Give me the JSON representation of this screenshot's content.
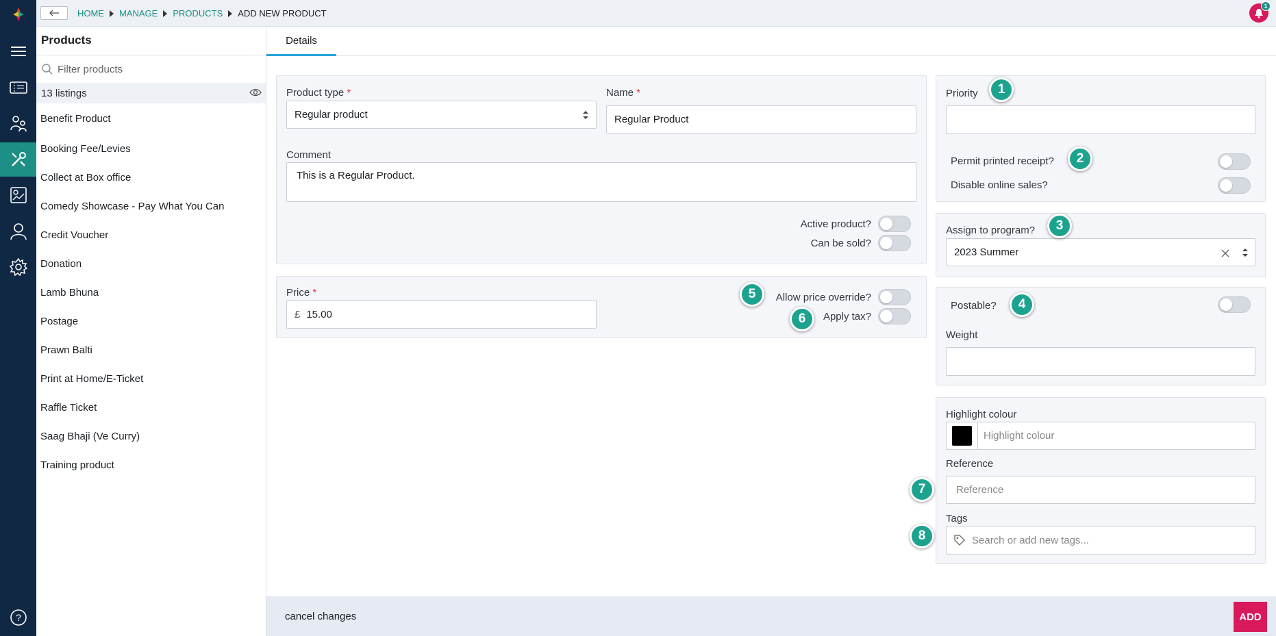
{
  "app": {
    "logo_icon": "brand-logo-icon",
    "accent": "#1d8f85",
    "brand": "#d8195c"
  },
  "rail": {
    "items": [
      "menu-icon",
      "ticket-icon",
      "people-icon",
      "tools-icon",
      "report-icon",
      "user-icon",
      "gear-icon",
      "help-icon"
    ]
  },
  "breadcrumb": {
    "home": "HOME",
    "manage": "MANAGE",
    "products": "PRODUCTS",
    "current": "ADD NEW PRODUCT"
  },
  "notifications": {
    "count": "1"
  },
  "sidebar": {
    "title": "Products",
    "filter_placeholder": "Filter products",
    "listing_count": "13",
    "listing_word": "listings",
    "items": [
      "Benefit Product",
      "Booking Fee/Levies",
      "Collect at Box office",
      "Comedy Showcase - Pay What You Can",
      "Credit Voucher",
      "Donation",
      "Lamb Bhuna",
      "Postage",
      "Prawn Balti",
      "Print at Home/E-Ticket",
      "Raffle Ticket",
      "Saag Bhaji (Ve Curry)",
      "Training product"
    ]
  },
  "tabs": {
    "details": "Details"
  },
  "form": {
    "product_type_label": "Product type",
    "product_type_value": "Regular product",
    "name_label": "Name",
    "name_value": "Regular Product",
    "comment_label": "Comment",
    "comment_value": "This is a Regular Product.",
    "active_label": "Active product?",
    "sold_label": "Can be sold?",
    "price_label": "Price",
    "currency": "£",
    "price_value": "15.00",
    "override_label": "Allow price override?",
    "tax_label": "Apply tax?",
    "priority_label": "Priority",
    "receipt_label": "Permit printed receipt?",
    "disable_online_label": "Disable online sales?",
    "program_label": "Assign to program?",
    "program_value": "2023 Summer",
    "postable_label": "Postable?",
    "weight_label": "Weight",
    "highlight_label": "Highlight colour",
    "highlight_placeholder": "Highlight colour",
    "highlight_swatch": "#000000",
    "reference_label": "Reference",
    "reference_placeholder": "Reference",
    "tags_label": "Tags",
    "tags_placeholder": "Search or add new tags..."
  },
  "toggles": {
    "active": false,
    "sold": false,
    "override": false,
    "tax": false,
    "receipt": false,
    "disable_online": false,
    "postable": false
  },
  "markers": [
    "1",
    "2",
    "3",
    "4",
    "5",
    "6",
    "7",
    "8"
  ],
  "footer": {
    "cancel": "cancel changes",
    "add": "ADD"
  }
}
